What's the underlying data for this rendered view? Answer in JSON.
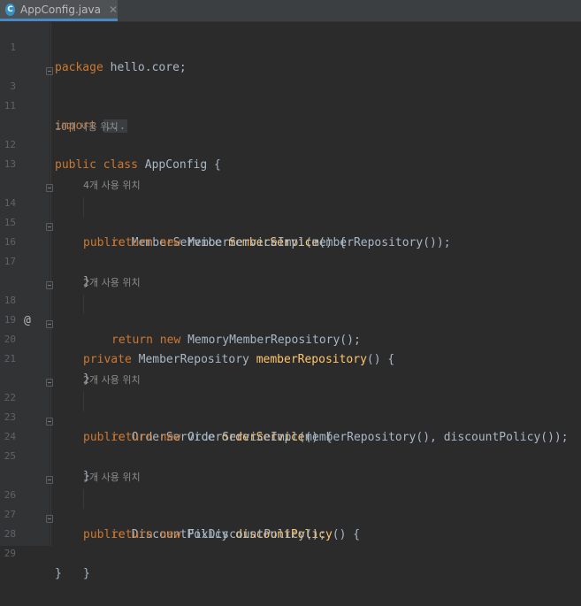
{
  "tab": {
    "icon_letter": "C",
    "filename": "AppConfig.java",
    "close": "✕"
  },
  "lines": {
    "l1": {
      "num": "1",
      "kw": "package",
      "rest": " hello.core;"
    },
    "l3": {
      "num": "3",
      "kw": "import",
      "folded": "..."
    },
    "l11": {
      "num": "11"
    },
    "h12": "10개 사용 위치",
    "l12": {
      "num": "12",
      "kw1": "public",
      "kw2": "class",
      "rest": " AppConfig {"
    },
    "l13": {
      "num": "13"
    },
    "h14": "4개 사용 위치",
    "l14": {
      "num": "14",
      "kw": "public",
      "type": " MemberService ",
      "fn": "memberService",
      "rest": "() {"
    },
    "l15": {
      "num": "15",
      "kw1": "return",
      "kw2": "new",
      "rest": " MemberServiceImpl(memberRepository());"
    },
    "l16": {
      "num": "16",
      "rest": "}"
    },
    "l17": {
      "num": "17"
    },
    "h18": "2개 사용 위치",
    "l18": {
      "num": "18",
      "marker": "@",
      "kw": "private",
      "type": " MemberRepository ",
      "fn": "memberRepository",
      "rest": "() {"
    },
    "l19": {
      "num": "19",
      "kw1": "return",
      "kw2": "new",
      "rest": " MemoryMemberRepository();"
    },
    "l20": {
      "num": "20",
      "rest": "}"
    },
    "l21": {
      "num": "21"
    },
    "h22": "2개 사용 위치",
    "l22": {
      "num": "22",
      "kw": "public",
      "type": " OrderService ",
      "fn": "orderService",
      "rest": "() {"
    },
    "l23": {
      "num": "23",
      "kw1": "return",
      "kw2": "new",
      "rest": " OrderServiceImpl(memberRepository(), discountPolicy());"
    },
    "l24": {
      "num": "24",
      "rest": "}"
    },
    "l25": {
      "num": "25"
    },
    "h26": "1개 사용 위치",
    "l26": {
      "num": "26",
      "kw": "public",
      "type": " DiscountPolicy ",
      "fn": "discountPolicy",
      "rest": "() {"
    },
    "l27": {
      "num": "27",
      "kw1": "return",
      "kw2": "new",
      "rest": " FixDiscountPolicy();"
    },
    "l28": {
      "num": "28",
      "rest": "}"
    },
    "l29": {
      "num": "29",
      "rest": "}"
    }
  },
  "colors": {
    "keyword": "#cc7832",
    "method": "#ffc66d",
    "text": "#a9b7c6",
    "background": "#2b2b2b"
  }
}
